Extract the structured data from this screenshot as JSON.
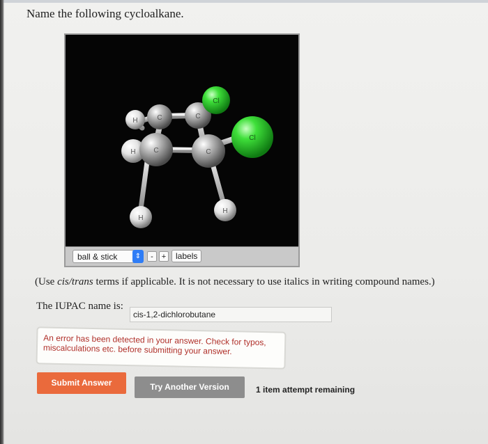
{
  "question": {
    "title": "Name the following cycloalkane."
  },
  "viewer": {
    "style_selected": "ball & stick",
    "zoom_out_label": "-",
    "zoom_in_label": "+",
    "labels_button": "labels",
    "atoms": {
      "cl": "Cl",
      "h": "H",
      "c": "C"
    },
    "colors": {
      "chlorine": "#22cc22",
      "carbon": "#9c9c9c",
      "hydrogen": "#e6e6e6",
      "background": "#050505"
    }
  },
  "instruction": {
    "prefix": "(Use ",
    "italic": "cis/trans",
    "suffix": " terms if applicable. It is not necessary to use italics in writing compound names.)"
  },
  "answer": {
    "label": "The IUPAC name is:",
    "value": "cis-1,2-dichlorobutane"
  },
  "feedback": {
    "error_message": "An error has been detected in your answer. Check for typos, miscalculations etc. before submitting your answer."
  },
  "buttons": {
    "submit": "Submit Answer",
    "try_another": "Try Another Version"
  },
  "attempts_remaining": "1 item attempt remaining",
  "theme": {
    "submit_color": "#ea6a3c",
    "try_color": "#8d8d8d",
    "error_color": "#b0302a"
  }
}
